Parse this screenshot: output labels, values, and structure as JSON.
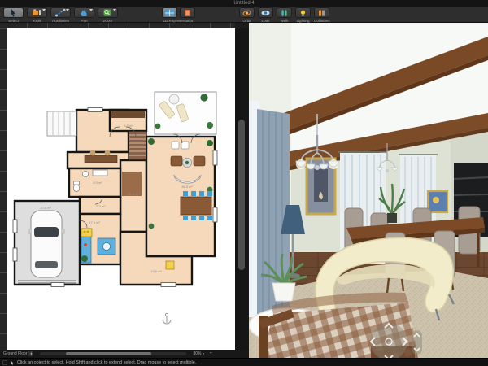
{
  "window": {
    "title": "Untitled 4"
  },
  "toolbar": {
    "left_buttons": [
      {
        "label": "Select"
      },
      {
        "label": "Tools"
      },
      {
        "label": "Auxiliaries"
      },
      {
        "label": "Pan"
      },
      {
        "label": "Zoom"
      }
    ],
    "rep_group_label": "2D Representation",
    "right_buttons": [
      {
        "label": "Orbit"
      },
      {
        "label": "Look"
      },
      {
        "label": "Walk"
      },
      {
        "label": "Lighting"
      },
      {
        "label": "Collisions"
      }
    ]
  },
  "floorplan": {
    "labels": {
      "closet": "5.5 m²",
      "bathroom": "8.0 m²",
      "wc": "6.0 m²",
      "hall": "26.5 m²",
      "living": "36.5 m²",
      "kitchen": "17.5 m²",
      "garage": "20.8 m²",
      "room": "18.6 m²"
    }
  },
  "bottom_bar": {
    "floor_selector": "Ground Floor",
    "zoom_level": "80%",
    "zoom_in_label": "+"
  },
  "status_bar": {
    "message": "Click an object to select. Hold Shift and click to extend select. Drag mouse to select multiple."
  },
  "colors": {
    "accent_blue": "#4a9fd8",
    "plan_floor": "#f6d9ba",
    "beam_wood": "#7a4a27",
    "sofa_cream": "#f2ecca"
  },
  "icons": {
    "select": "cursor-arrow",
    "tools": "furniture-tools",
    "auxiliaries": "dashed-line",
    "pan": "hand",
    "zoom": "magnifier",
    "rep_2d": "plan-view",
    "rep_elevation": "elevation-view",
    "orbit": "orbit-ring",
    "look": "eye",
    "walk": "legs",
    "lighting": "bulb",
    "collisions": "blocks"
  }
}
